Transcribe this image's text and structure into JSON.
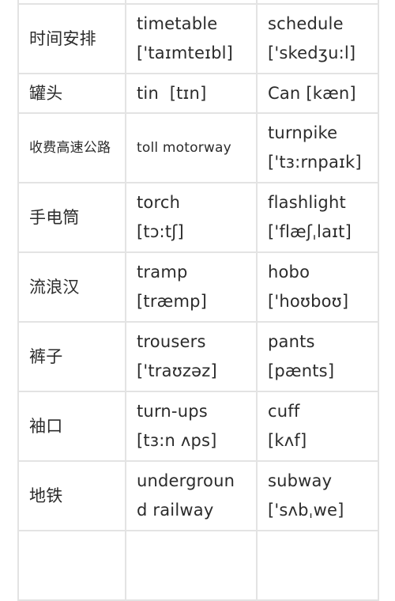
{
  "table": {
    "rows": [
      {
        "chinese": "",
        "british": [
          ""
        ],
        "american": [
          ""
        ]
      },
      {
        "chinese": "时间安排",
        "british": [
          "timetable",
          "['taɪmteɪbl]"
        ],
        "american": [
          "schedule",
          "['skedʒu:l]"
        ]
      },
      {
        "chinese": "罐头",
        "british": [
          "tin  [tɪn]"
        ],
        "american": [
          "Can [kæn]"
        ]
      },
      {
        "chinese": "收费高速公路",
        "british": [
          "toll motorway"
        ],
        "american": [
          "turnpike",
          "['tɜ:rnpaɪk]"
        ]
      },
      {
        "chinese": "手电筒",
        "british": [
          "torch",
          "[tɔ:tʃ]"
        ],
        "american": [
          "flashlight",
          "['flæʃˌlaɪt]"
        ]
      },
      {
        "chinese": "流浪汉",
        "british": [
          "tramp",
          "[træmp]"
        ],
        "american": [
          "hobo",
          "['hoʊboʊ]"
        ]
      },
      {
        "chinese": "裤子",
        "british": [
          "trousers",
          "['traʊzəz]"
        ],
        "american": [
          "pants",
          "[pænts]"
        ]
      },
      {
        "chinese": "袖口",
        "british": [
          "turn-ups",
          "[tɜ:n ʌps]"
        ],
        "american": [
          "cuff",
          "[kʌf]"
        ]
      },
      {
        "chinese": "地铁",
        "british": [
          "undergroun",
          "d railway"
        ],
        "american": [
          "subway",
          "['sʌbˌwe]"
        ]
      },
      {
        "chinese": "",
        "british": [
          ""
        ],
        "american": [
          ""
        ]
      }
    ]
  }
}
